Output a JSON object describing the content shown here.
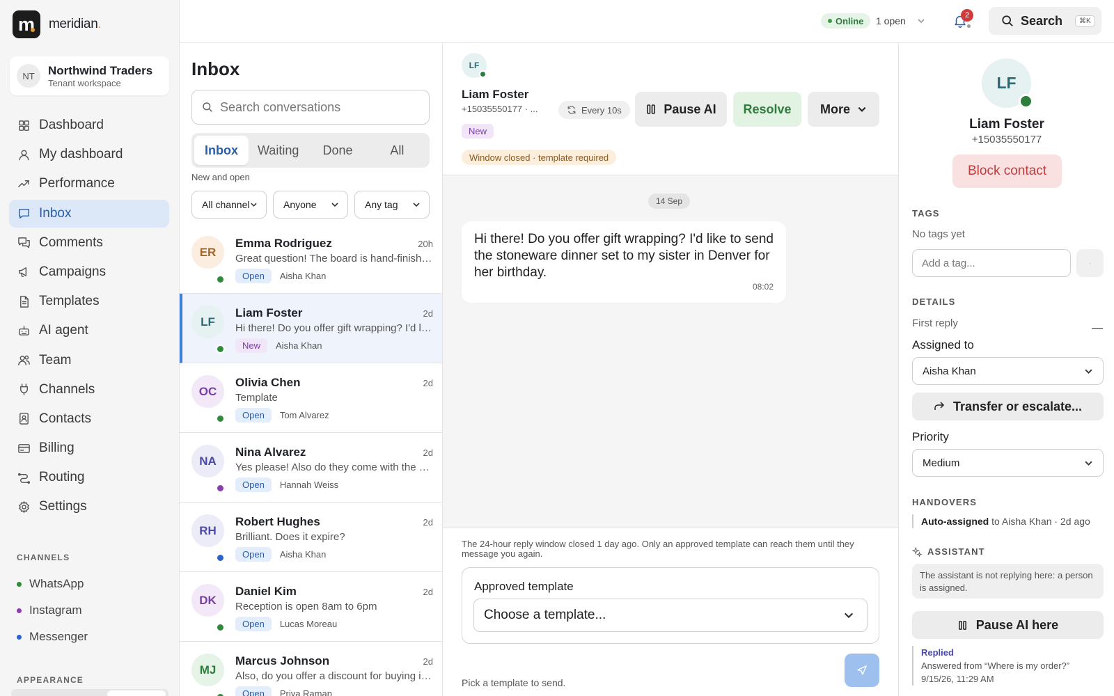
{
  "brand": {
    "logo_letter": "m",
    "name": "meridian",
    "dot": "."
  },
  "tenant": {
    "initials": "NT",
    "name": "Northwind Traders",
    "sub": "Tenant workspace"
  },
  "nav": [
    {
      "label": "Dashboard",
      "icon": "grid-icon"
    },
    {
      "label": "My dashboard",
      "icon": "user-icon"
    },
    {
      "label": "Performance",
      "icon": "trend-icon"
    },
    {
      "label": "Inbox",
      "icon": "chat-icon",
      "active": true
    },
    {
      "label": "Comments",
      "icon": "comments-icon"
    },
    {
      "label": "Campaigns",
      "icon": "megaphone-icon"
    },
    {
      "label": "Templates",
      "icon": "document-icon"
    },
    {
      "label": "AI agent",
      "icon": "robot-icon"
    },
    {
      "label": "Team",
      "icon": "team-icon"
    },
    {
      "label": "Channels",
      "icon": "plug-icon"
    },
    {
      "label": "Contacts",
      "icon": "contact-book-icon"
    },
    {
      "label": "Billing",
      "icon": "card-icon"
    },
    {
      "label": "Routing",
      "icon": "routing-icon"
    },
    {
      "label": "Settings",
      "icon": "gear-icon"
    }
  ],
  "channels_label": "CHANNELS",
  "channels": [
    {
      "label": "WhatsApp",
      "color": "#2f8a3c"
    },
    {
      "label": "Instagram",
      "color": "#8a3fb0"
    },
    {
      "label": "Messenger",
      "color": "#2d63c8"
    }
  ],
  "appearance_label": "APPEARANCE",
  "topbar": {
    "status": "Online",
    "open_count": "1 open",
    "notifications": "2",
    "search_label": "Search",
    "search_shortcut": "⌘K"
  },
  "inbox": {
    "title": "Inbox",
    "search_placeholder": "Search conversations",
    "tabs": [
      "Inbox",
      "Waiting",
      "Done",
      "All"
    ],
    "subtitle": "New and open",
    "filters": [
      "All channels",
      "Anyone",
      "Any tag"
    ],
    "conversations": [
      {
        "initials": "ER",
        "name": "Emma Rodriguez",
        "time": "20h",
        "preview": "Great question! The board is hand-finished with food-safe oil",
        "status": "Open",
        "agent": "Aisha Khan",
        "avatar_bg": "#fbeee0",
        "avatar_fg": "#a5662a",
        "channel_color": "#2f8a3c"
      },
      {
        "initials": "LF",
        "name": "Liam Foster",
        "time": "2d",
        "preview": "Hi there! Do you offer gift wrapping? I'd like to send the",
        "status": "New",
        "agent": "Aisha Khan",
        "avatar_bg": "#e6f1f2",
        "avatar_fg": "#2d6970",
        "channel_color": "#2f8a3c",
        "selected": true
      },
      {
        "initials": "OC",
        "name": "Olivia Chen",
        "time": "2d",
        "preview": "Template",
        "status": "Open",
        "agent": "Tom Alvarez",
        "avatar_bg": "#f2e8f7",
        "avatar_fg": "#7a3fa7",
        "channel_color": "#2f8a3c"
      },
      {
        "initials": "NA",
        "name": "Nina Alvarez",
        "time": "2d",
        "preview": "Yes please! Also do they come with the stand?",
        "status": "Open",
        "agent": "Hannah Weiss",
        "avatar_bg": "#ecebf8",
        "avatar_fg": "#4d4aa8",
        "channel_color": "#8a3fb0"
      },
      {
        "initials": "RH",
        "name": "Robert Hughes",
        "time": "2d",
        "preview": "Brilliant. Does it expire?",
        "status": "Open",
        "agent": "Aisha Khan",
        "avatar_bg": "#ecebf8",
        "avatar_fg": "#4d4aa8",
        "channel_color": "#2d63c8"
      },
      {
        "initials": "DK",
        "name": "Daniel Kim",
        "time": "2d",
        "preview": "Reception is open 8am to 6pm",
        "status": "Open",
        "agent": "Lucas Moreau",
        "avatar_bg": "#f2e8f7",
        "avatar_fg": "#7a3fa7",
        "channel_color": "#2f8a3c"
      },
      {
        "initials": "MJ",
        "name": "Marcus Johnson",
        "time": "2d",
        "preview": "Also, do you offer a discount for buying in bulk?",
        "status": "Open",
        "agent": "Priya Raman",
        "avatar_bg": "#e5f4e7",
        "avatar_fg": "#2f7d3c",
        "channel_color": "#2f8a3c"
      }
    ]
  },
  "thread": {
    "initials": "LF",
    "name": "Liam Foster",
    "phone": "+15035550177 · ...",
    "status": "New",
    "warning": "Window closed · template required",
    "refresh": "Every 10s",
    "pause_label": "Pause AI",
    "resolve_label": "Resolve",
    "more_label": "More",
    "date": "14 Sep",
    "message": "Hi there! Do you offer gift wrapping? I'd like to send the stoneware dinner set to my sister in Denver for her birthday.",
    "message_time": "08:02",
    "window_note": "The 24-hour reply window closed 1 day ago. Only an approved template can reach them until they message you again.",
    "template_label": "Approved template",
    "template_placeholder": "Choose a template...",
    "pick_note": "Pick a template to send."
  },
  "contact": {
    "initials": "LF",
    "name": "Liam Foster",
    "phone": "+15035550177",
    "block_label": "Block contact",
    "tags_label": "TAGS",
    "no_tags": "No tags yet",
    "tag_placeholder": "Add a tag...",
    "details_label": "DETAILS",
    "first_reply_label": "First reply",
    "first_reply_value": "—",
    "assigned_label": "Assigned to",
    "assigned_value": "Aisha Khan",
    "transfer_label": "Transfer or escalate...",
    "priority_label": "Priority",
    "priority_value": "Medium",
    "handovers_label": "HANDOVERS",
    "handover_bold": "Auto-assigned",
    "handover_rest": "to Aisha Khan · 2d ago",
    "assistant_label": "ASSISTANT",
    "assistant_note": "The assistant is not replying here: a person is assigned.",
    "pause_here_label": "Pause AI here",
    "replied_title": "Replied",
    "replied_text": "Answered from “Where is my order?”",
    "replied_time": "9/15/26, 11:29 AM"
  }
}
